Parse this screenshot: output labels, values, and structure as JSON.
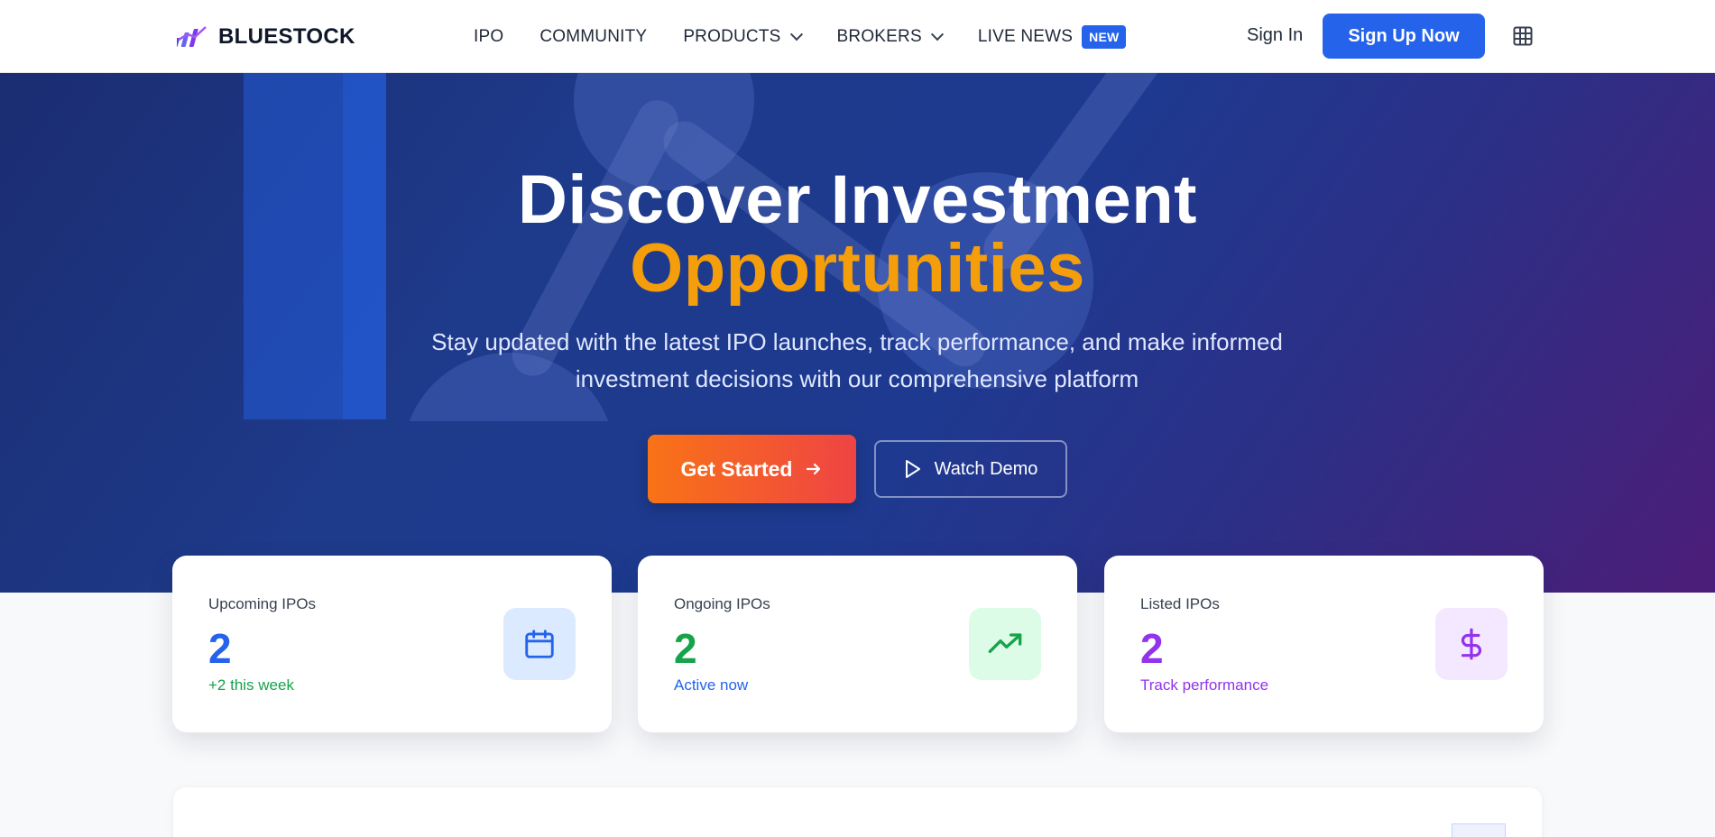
{
  "nav": {
    "brand": "BLUESTOCK",
    "links": [
      {
        "label": "IPO"
      },
      {
        "label": "COMMUNITY"
      },
      {
        "label": "PRODUCTS",
        "dropdown": true
      },
      {
        "label": "BROKERS",
        "dropdown": true
      },
      {
        "label": "LIVE NEWS",
        "badge": "NEW"
      }
    ],
    "signin": "Sign In",
    "signup": "Sign Up Now",
    "apps_icon": "grid-icon"
  },
  "hero": {
    "title_line1": "Discover Investment",
    "title_line2": "Opportunities",
    "subtitle": "Stay updated with the latest IPO launches, track performance, and make informed investment decisions with our comprehensive platform",
    "cta_primary": "Get Started",
    "cta_secondary": "Watch Demo"
  },
  "stats": [
    {
      "label": "Upcoming IPOs",
      "value": "2",
      "note": "+2 this week",
      "icon": "calendar-icon",
      "color": "#2563eb",
      "note_color": "#16a34a",
      "icon_bg": "#dbeafe"
    },
    {
      "label": "Ongoing IPOs",
      "value": "2",
      "note": "Active now",
      "icon": "trending-up-icon",
      "color": "#16a34a",
      "note_color": "#2563eb",
      "icon_bg": "#dcfce7"
    },
    {
      "label": "Listed IPOs",
      "value": "2",
      "note": "Track performance",
      "icon": "dollar-icon",
      "color": "#9333ea",
      "note_color": "#9333ea",
      "icon_bg": "#f3e8ff"
    }
  ],
  "colors": {
    "accent": "#2563eb",
    "highlight": "#f59e0b",
    "cta_start": "#f97316",
    "cta_end": "#ef4444"
  }
}
